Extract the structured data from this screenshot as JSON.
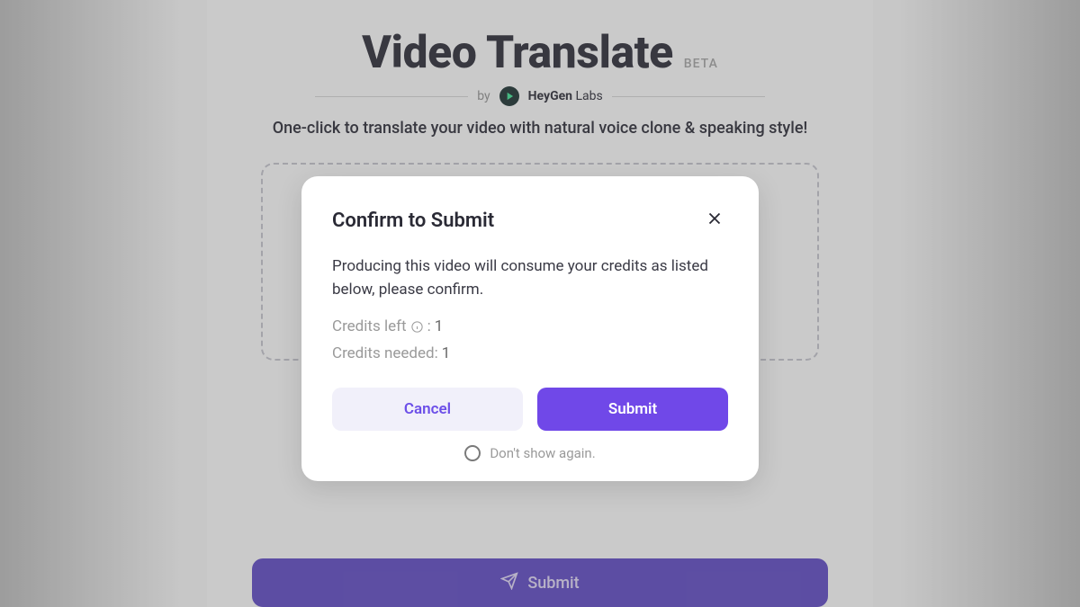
{
  "header": {
    "title": "Video Translate",
    "badge": "BETA",
    "by_prefix": "by",
    "brand_bold": "HeyGen",
    "brand_light": " Labs",
    "subtitle": "One-click to translate your video with natural voice clone & speaking style!"
  },
  "submit_bar": {
    "label": "Submit"
  },
  "modal": {
    "title": "Confirm to Submit",
    "body": "Producing this video will consume your credits as listed below, please confirm.",
    "credits_left_label": "Credits left",
    "credits_left_suffix": " : ",
    "credits_left_value": "1",
    "credits_needed_label": "Credits needed: ",
    "credits_needed_value": "1",
    "cancel_label": "Cancel",
    "submit_label": "Submit",
    "dont_show_label": "Don't show again."
  }
}
